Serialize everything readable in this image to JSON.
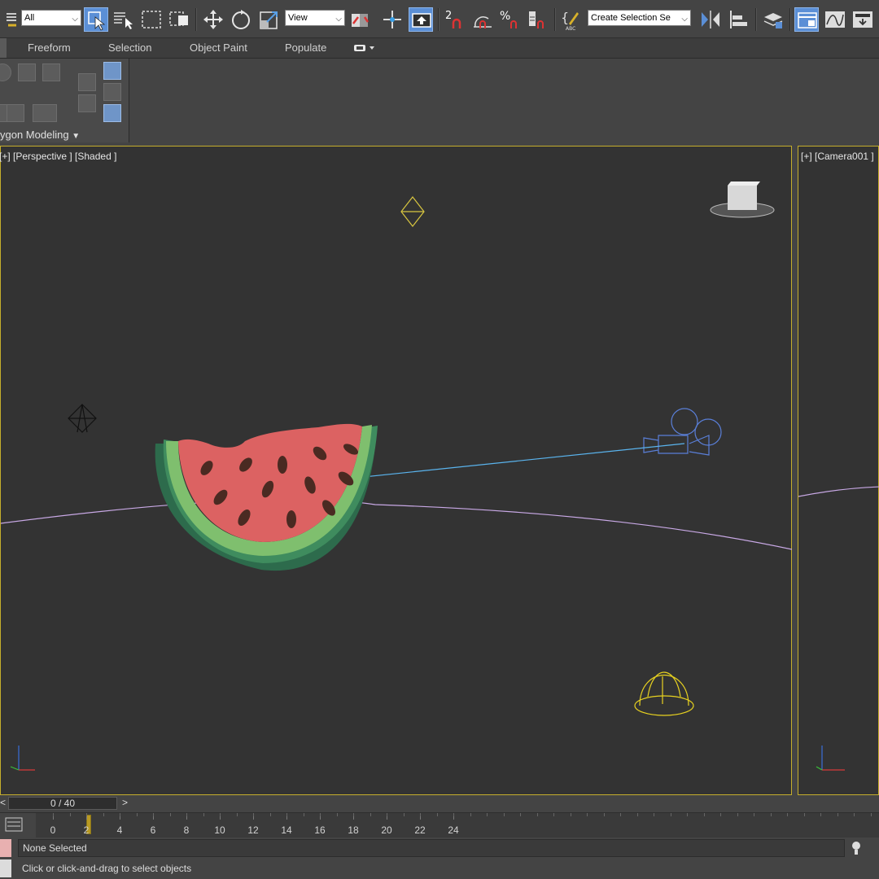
{
  "toolbar": {
    "selection_filter": "All",
    "reference_coord": "View",
    "named_selection_placeholder": "Create Selection Se"
  },
  "ribbon": {
    "tabs": [
      "Freeform",
      "Selection",
      "Object Paint",
      "Populate"
    ],
    "panel_title": "ygon Modeling"
  },
  "viewports": {
    "perspective": {
      "label": "[+] [Perspective ] [Shaded ]"
    },
    "camera": {
      "label": "[+] [Camera001 ]"
    }
  },
  "timeline": {
    "frame_display": "0 / 40",
    "prev": "<",
    "next": ">",
    "ticks": [
      "0",
      "2",
      "4",
      "6",
      "8",
      "10",
      "12",
      "14",
      "16",
      "18",
      "20",
      "22",
      "24"
    ]
  },
  "status": {
    "selection": "None Selected",
    "prompt": "Click or click-and-drag to select objects"
  },
  "colors": {
    "viewport_border": "#c5ae2c",
    "active_button": "#5b8fd6",
    "light_helper": "#d8c640",
    "camera_helper": "#5a7fd8",
    "ground_curve": "#c9a9e6",
    "watermelon_flesh": "#dc6262",
    "watermelon_rind": "#7fbf6e"
  }
}
